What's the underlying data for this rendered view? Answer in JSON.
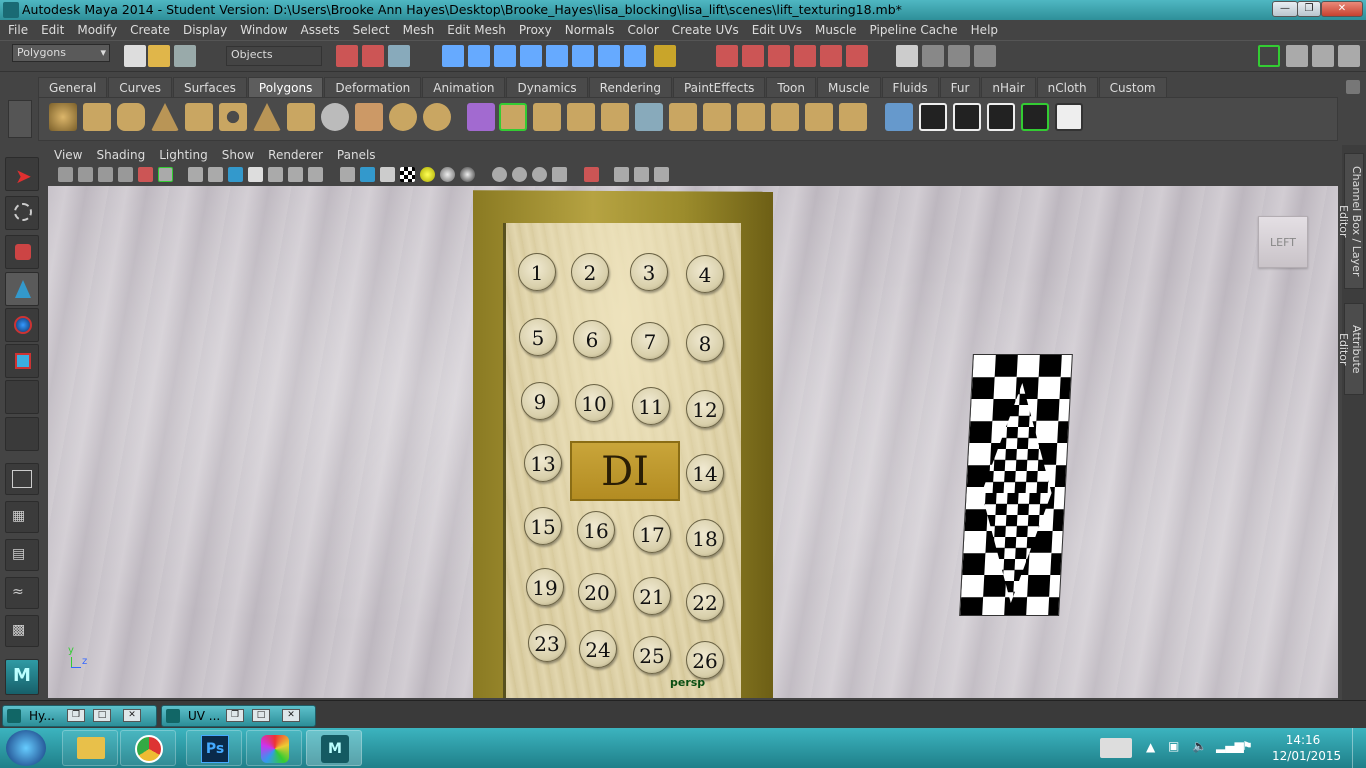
{
  "window": {
    "title": "Autodesk Maya 2014 - Student Version: D:\\Users\\Brooke Ann Hayes\\Desktop\\Brooke_Hayes\\lisa_blocking\\lisa_lift\\scenes\\lift_texturing18.mb*"
  },
  "menus": [
    "File",
    "Edit",
    "Modify",
    "Create",
    "Display",
    "Window",
    "Assets",
    "Select",
    "Mesh",
    "Edit Mesh",
    "Proxy",
    "Normals",
    "Color",
    "Create UVs",
    "Edit UVs",
    "Muscle",
    "Pipeline Cache",
    "Help"
  ],
  "status": {
    "mode": "Polygons",
    "select_field": "Objects"
  },
  "shelf_tabs": [
    "General",
    "Curves",
    "Surfaces",
    "Polygons",
    "Deformation",
    "Animation",
    "Dynamics",
    "Rendering",
    "PaintEffects",
    "Toon",
    "Muscle",
    "Fluids",
    "Fur",
    "nHair",
    "nCloth",
    "Custom"
  ],
  "shelf_active": "Polygons",
  "panel_menus": [
    "View",
    "Shading",
    "Lighting",
    "Show",
    "Renderer",
    "Panels"
  ],
  "viewport": {
    "camera_label": "persp",
    "viewcube_label": "LEFT",
    "plate_text": "DI",
    "axis_y": "y",
    "axis_z": "z"
  },
  "buttons": [
    "1",
    "2",
    "3",
    "4",
    "5",
    "6",
    "7",
    "8",
    "9",
    "10",
    "11",
    "12",
    "13",
    "14",
    "15",
    "16",
    "17",
    "18",
    "19",
    "20",
    "21",
    "22",
    "23",
    "24",
    "25",
    "26"
  ],
  "side_tabs": [
    "Channel Box / Layer Editor",
    "Attribute Editor"
  ],
  "minimized": [
    {
      "label": "Hy..."
    },
    {
      "label": "UV ..."
    }
  ],
  "clock": {
    "time": "14:16",
    "date": "12/01/2015"
  },
  "taskbar_apps": [
    "start",
    "explorer",
    "chrome",
    "photoshop",
    "paint",
    "maya"
  ]
}
